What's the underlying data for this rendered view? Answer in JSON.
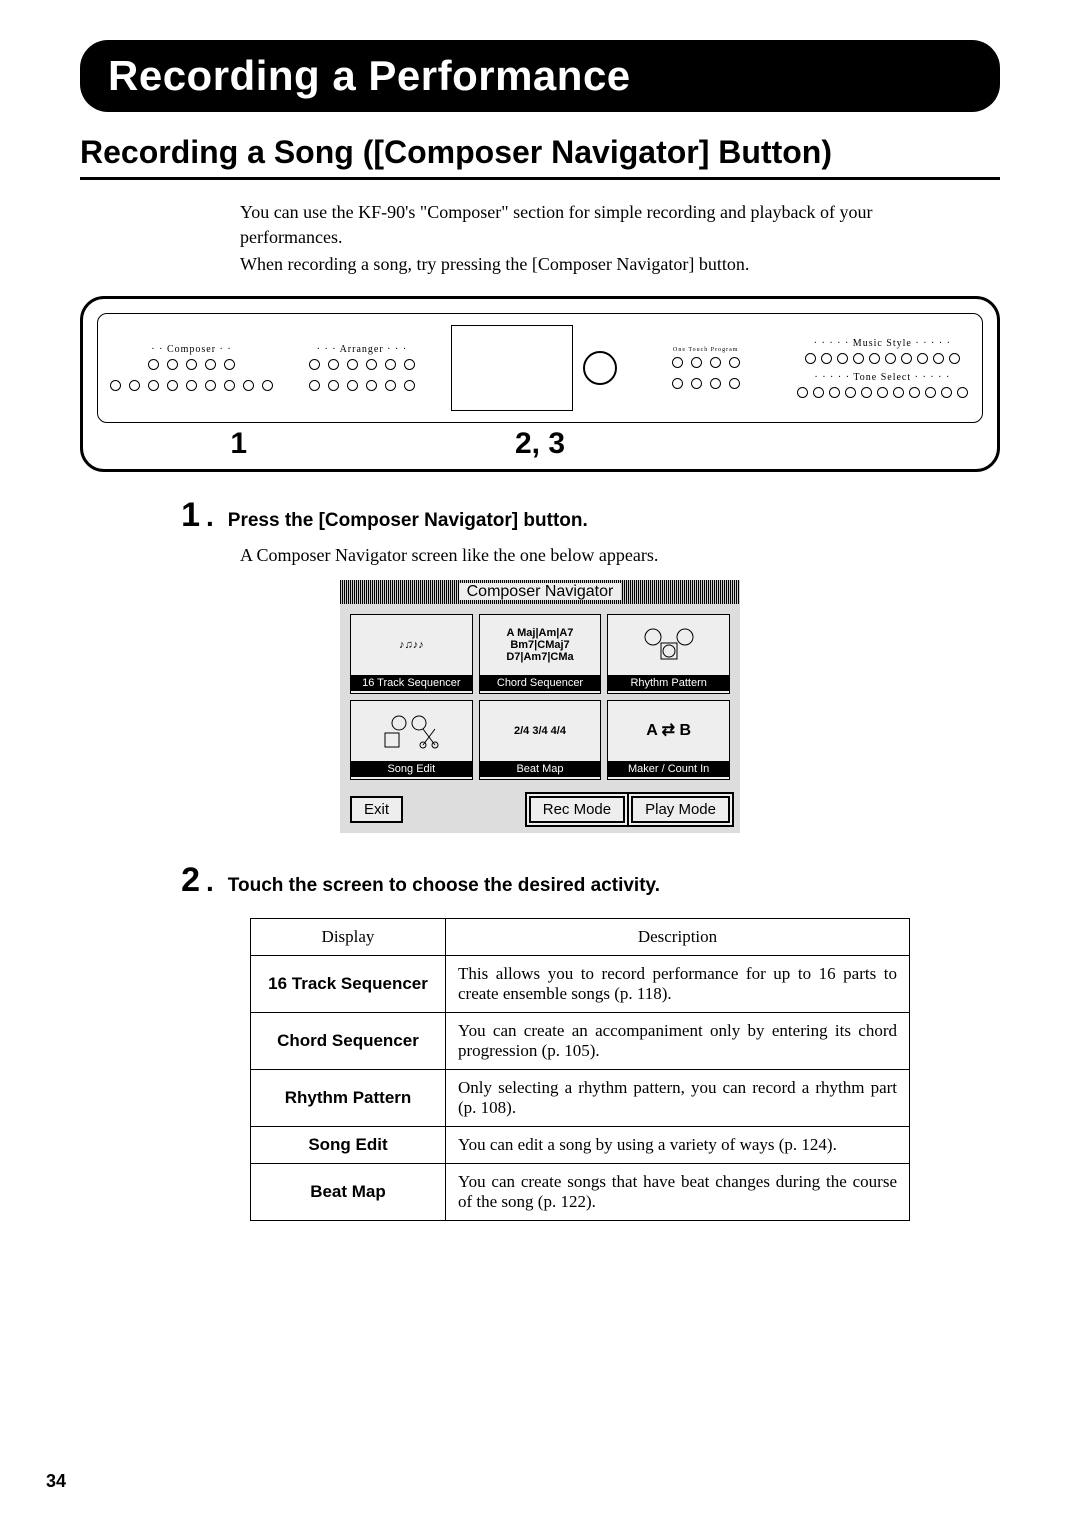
{
  "header": {
    "chapter_title": "Recording a Performance",
    "section_title": "Recording a Song ([Composer Navigator] Button)"
  },
  "intro_lines": [
    "You can use the KF-90's \"Composer\" section for simple recording and playback of your performances.",
    "When recording a song, try pressing the [Composer Navigator] button."
  ],
  "panel": {
    "callout_1": "1",
    "callout_23": "2, 3"
  },
  "steps": [
    {
      "num": "1",
      "title": "Press the [Composer Navigator] button.",
      "body": "A Composer Navigator screen like the one below appears."
    },
    {
      "num": "2",
      "title": "Touch the screen to choose the desired activity.",
      "body": ""
    }
  ],
  "navigator": {
    "title": "Composer Navigator",
    "cells": [
      {
        "icon_hint": "♪♫",
        "caption": "16 Track Sequencer"
      },
      {
        "icon_hint": "A Maj|Am|A7 Bm7|CMaj7 D7|Am7|CMa",
        "caption": "Chord Sequencer"
      },
      {
        "icon_hint": "drum-kit",
        "caption": "Rhythm Pattern"
      },
      {
        "icon_hint": "tape+scissors",
        "caption": "Song Edit"
      },
      {
        "icon_hint": "2/4 3/4 4/4",
        "caption": "Beat Map"
      },
      {
        "icon_hint": "A ⇄ B",
        "caption": "Maker / Count In"
      }
    ],
    "exit_label": "Exit",
    "rec_label": "Rec Mode",
    "play_label": "Play Mode"
  },
  "table": {
    "head_display": "Display",
    "head_desc": "Description",
    "rows": [
      {
        "display": "16 Track Sequencer",
        "desc": "This allows you to record performance for up to 16 parts to create ensemble songs (p. 118)."
      },
      {
        "display": "Chord Sequencer",
        "desc": "You can create an accompaniment only by entering its chord progression (p. 105)."
      },
      {
        "display": "Rhythm Pattern",
        "desc": "Only selecting a rhythm pattern, you can record a rhythm part (p. 108)."
      },
      {
        "display": "Song Edit",
        "desc": "You can edit a song by using a variety of ways (p. 124)."
      },
      {
        "display": "Beat Map",
        "desc": "You can create songs that have beat changes during the course of the song (p. 122)."
      }
    ]
  },
  "page_number": "34"
}
